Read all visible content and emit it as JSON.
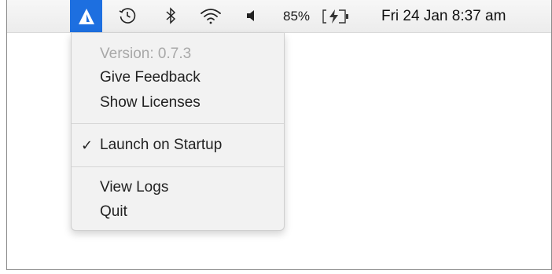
{
  "menubar": {
    "app_icon": "app-logo-icon",
    "icons": [
      "time-machine-icon",
      "bluetooth-icon",
      "wifi-icon",
      "volume-icon"
    ],
    "battery_percent": "85%",
    "battery_icon": "battery-charging-icon",
    "clock": "Fri 24 Jan  8:37 am"
  },
  "menu": {
    "version": "Version: 0.7.3",
    "give_feedback": "Give Feedback",
    "show_licenses": "Show Licenses",
    "launch_on_startup": "Launch on Startup",
    "launch_on_startup_checked": true,
    "checkmark": "✓",
    "view_logs": "View Logs",
    "quit": "Quit"
  },
  "colors": {
    "app_icon_bg": "#1d6fe0",
    "menu_bg": "#f2f2f2",
    "disabled_text": "#a8a8a8"
  }
}
